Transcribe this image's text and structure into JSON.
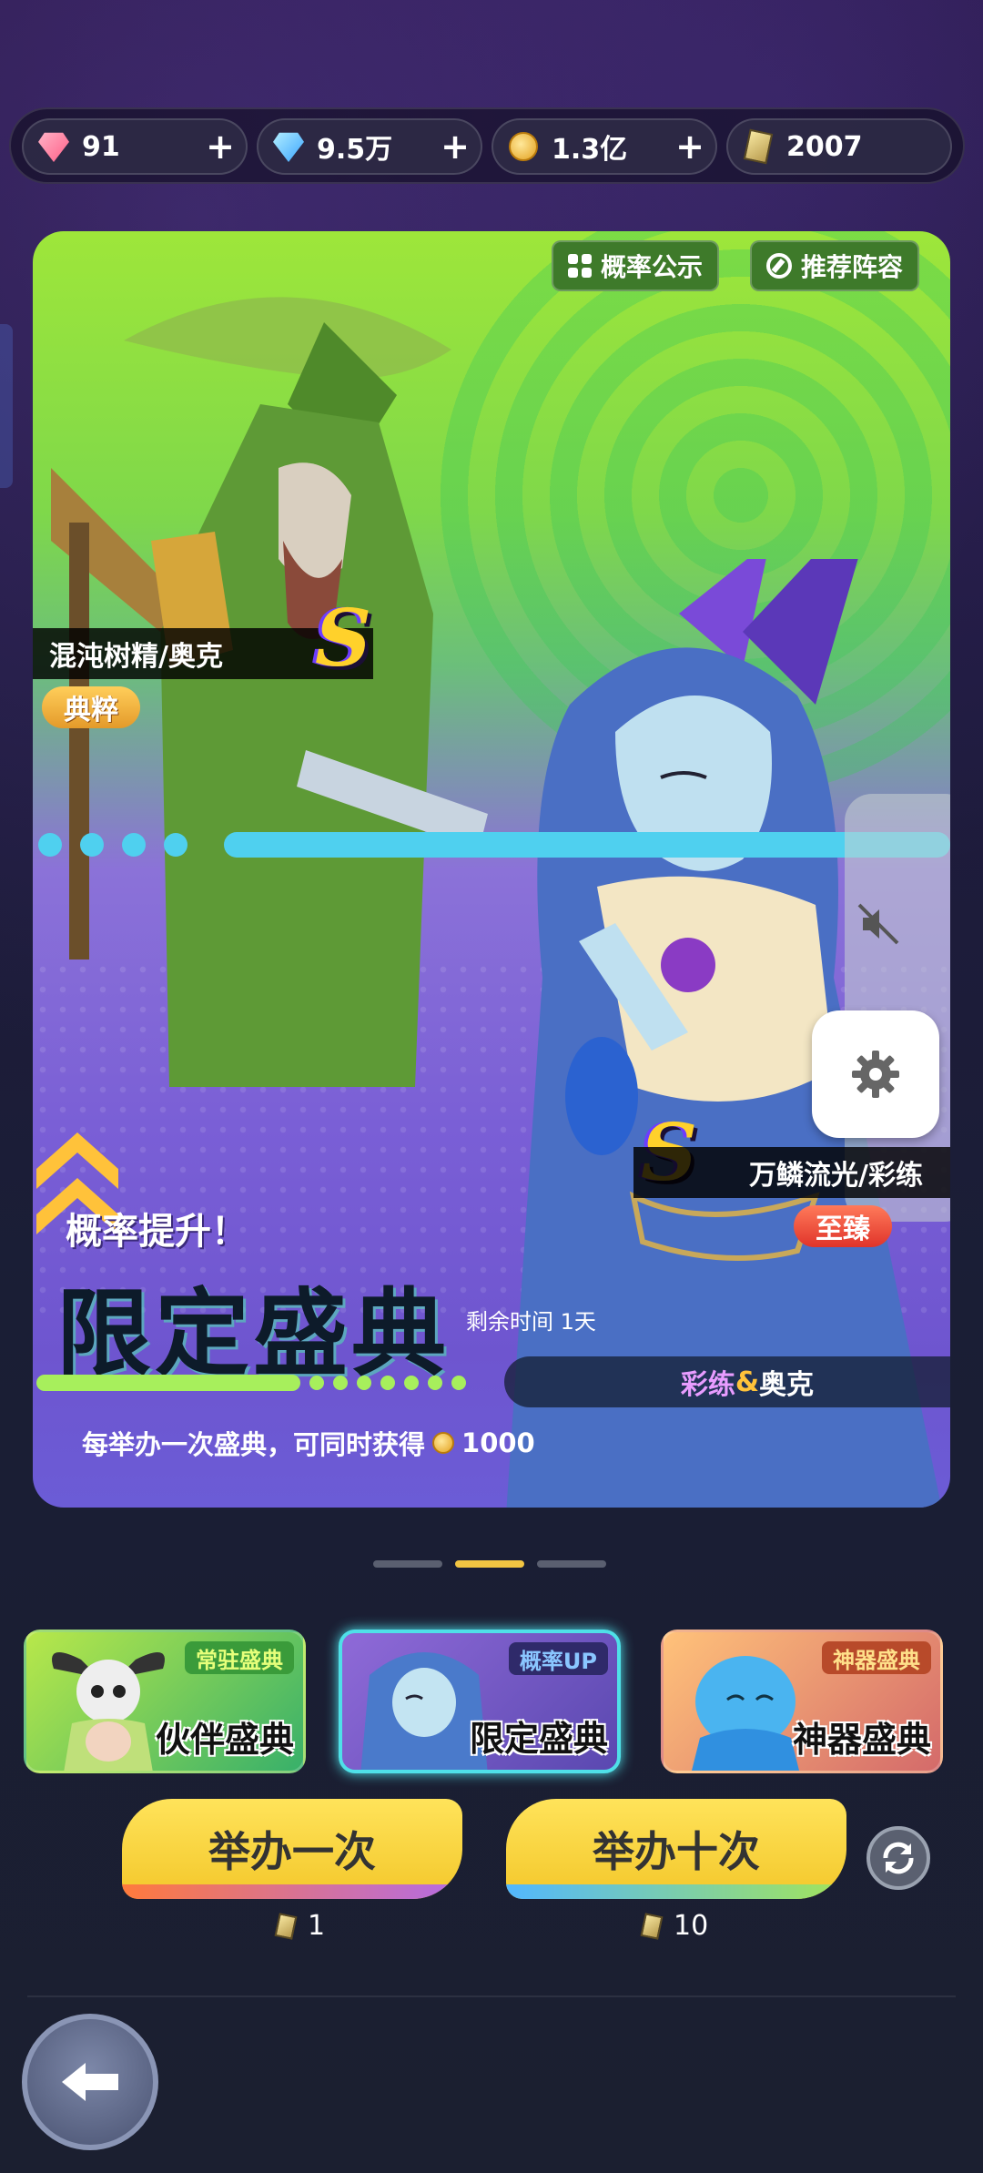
{
  "currencies": [
    {
      "icon": "pink-diamond-icon",
      "value": "91",
      "plus": "+"
    },
    {
      "icon": "blue-diamond-icon",
      "value": "9.5万",
      "plus": "+"
    },
    {
      "icon": "gold-coin-icon",
      "value": "1.3亿",
      "plus": "+"
    },
    {
      "icon": "summon-ticket-icon",
      "value": "2007"
    }
  ],
  "banner": {
    "btn_probability": "概率公示",
    "btn_recommend": "推荐阵容",
    "hero_left_name": "混沌树精/奥克",
    "hero_left_rank": "S",
    "hero_left_tier": "典粹",
    "hero_right_name": "万鳞流光/彩练",
    "hero_right_rank": "S",
    "hero_right_tier": "至臻",
    "rate_up": "概率提升！",
    "title": "限定盛典",
    "remaining": "剩余时间  1天",
    "pair_a": "彩练",
    "pair_amp": "&",
    "pair_b": "奥克",
    "bonus_text": "每举办一次盛典，可同时获得",
    "bonus_amount": "1000"
  },
  "tabs": [
    {
      "tag": "常驻盛典",
      "label": "伙伴盛典"
    },
    {
      "tag": "概率UP",
      "label": "限定盛典"
    },
    {
      "tag": "神器盛典",
      "label": "神器盛典"
    }
  ],
  "actions": {
    "once_label": "举办一次",
    "once_cost": "1",
    "ten_label": "举办十次",
    "ten_cost": "10"
  },
  "colors": {
    "accent": "#f2c542",
    "active_tab": "#4fe0e8",
    "banner_green": "#9ee63a",
    "banner_purple": "#7a5fd6"
  }
}
